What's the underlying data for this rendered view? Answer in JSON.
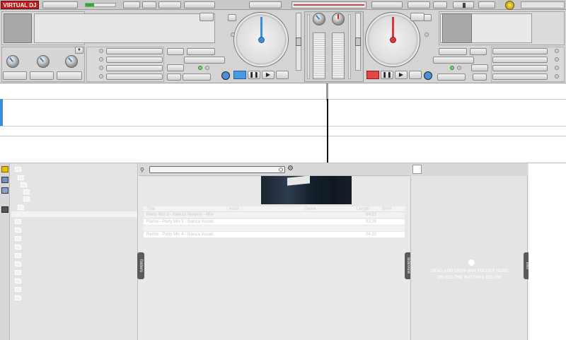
{
  "app": {
    "logo_text": "VIRTUAL DJ"
  },
  "colors": {
    "deck_left_accent": "#3a8fd8",
    "deck_right_accent": "#d83a3a",
    "vu_green": "#21b321"
  },
  "browser": {
    "folders": {
      "tab_label": "folders"
    },
    "search": {
      "value": "",
      "gear_icon": "gear-icon",
      "mic_icon": "mic-icon"
    },
    "file_list": {
      "columns": [
        "Title",
        "Artist",
        "Genre",
        "Length",
        "BPM"
      ],
      "rows": [
        {
          "title": "Party Mix 2 - Ibanza Version - Mix",
          "time": "04:27"
        },
        {
          "title": "Remix - Party Mix 3 - Ibanza Vocals",
          "time": "03:20"
        },
        {
          "title": "",
          "time": ""
        },
        {
          "title": "Remix - Party Mix 4 - Ibanza Vocals",
          "time": "04:22"
        }
      ]
    },
    "sideview": {
      "tab_label": "sideview",
      "message_line1": "DRAG AND DROP ANY FOLDER HERE",
      "message_line2": "OR USE THE BUTTONS BELOW"
    },
    "info": {
      "tab_label": "info"
    }
  }
}
